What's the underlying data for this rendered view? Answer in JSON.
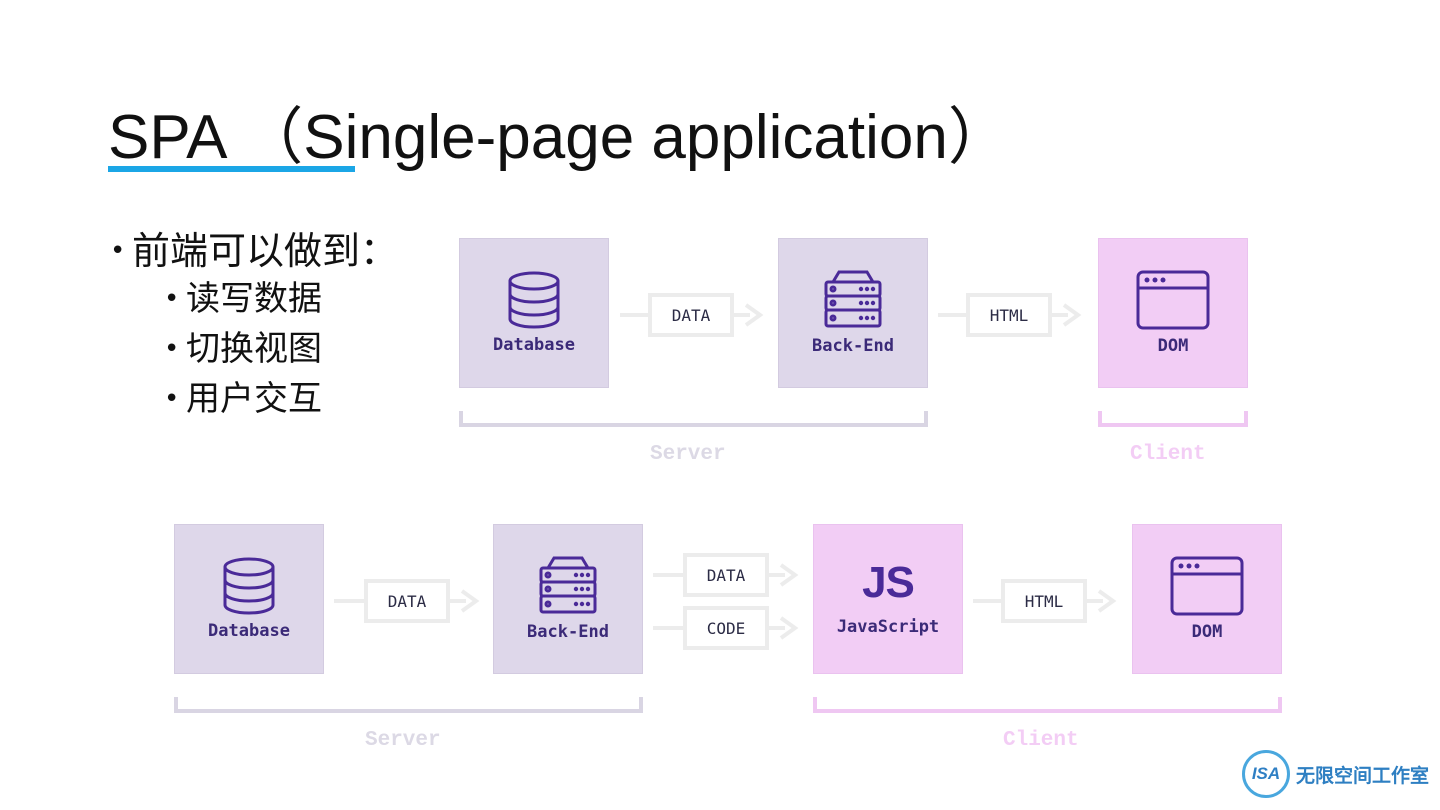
{
  "title": "SPA （Single-page application）",
  "bullets": {
    "main": "前端可以做到：",
    "subs": [
      "读写数据",
      "切换视图",
      "用户交互"
    ]
  },
  "diagram_top": {
    "nodes": {
      "database": "Database",
      "backend": "Back-End",
      "dom": "DOM"
    },
    "arrows": {
      "data": "DATA",
      "html": "HTML"
    },
    "groups": {
      "server": "Server",
      "client": "Client"
    }
  },
  "diagram_bottom": {
    "nodes": {
      "database": "Database",
      "backend": "Back-End",
      "js_logo": "JS",
      "javascript": "JavaScript",
      "dom": "DOM"
    },
    "arrows": {
      "data1": "DATA",
      "data2": "DATA",
      "code": "CODE",
      "html": "HTML"
    },
    "groups": {
      "server": "Server",
      "client": "Client"
    }
  },
  "colors": {
    "accent": "#1ba6e6",
    "server_box": "#ded7ea",
    "client_box": "#f2cdf5",
    "icon": "#4a2a98"
  },
  "icons": [
    "database-icon",
    "server-rack-icon",
    "browser-window-icon",
    "arrow-right-icon"
  ],
  "watermark": {
    "logo": "ISA",
    "text": "无限空间工作室"
  }
}
